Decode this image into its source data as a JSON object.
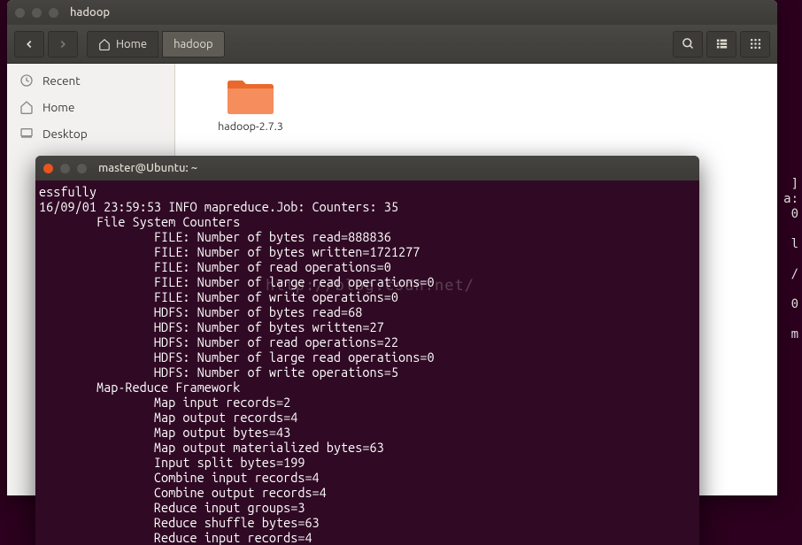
{
  "file_manager": {
    "title": "hadoop",
    "path": {
      "home": "Home",
      "current": "hadoop"
    },
    "sidebar": {
      "recent": "Recent",
      "home": "Home",
      "desktop": "Desktop"
    },
    "folder": {
      "name": "hadoop-2.7.3"
    }
  },
  "terminal": {
    "title": "master@Ubuntu: ~",
    "lines": [
      "essfully",
      "16/09/01 23:59:53 INFO mapreduce.Job: Counters: 35",
      "        File System Counters",
      "                FILE: Number of bytes read=888836",
      "                FILE: Number of bytes written=1721277",
      "                FILE: Number of read operations=0",
      "                FILE: Number of large read operations=0",
      "                FILE: Number of write operations=0",
      "                HDFS: Number of bytes read=68",
      "                HDFS: Number of bytes written=27",
      "                HDFS: Number of read operations=22",
      "                HDFS: Number of large read operations=0",
      "                HDFS: Number of write operations=5",
      "        Map-Reduce Framework",
      "                Map input records=2",
      "                Map output records=4",
      "                Map output bytes=43",
      "                Map output materialized bytes=63",
      "                Input split bytes=199",
      "                Combine input records=4",
      "                Combine output records=4",
      "                Reduce input groups=3",
      "                Reduce shuffle bytes=63",
      "                Reduce input records=4"
    ]
  },
  "watermark": "http://blog.csdn.net/",
  "right_fragments": [
    "]",
    "a:",
    "0",
    "l",
    "/",
    "0",
    "m"
  ]
}
